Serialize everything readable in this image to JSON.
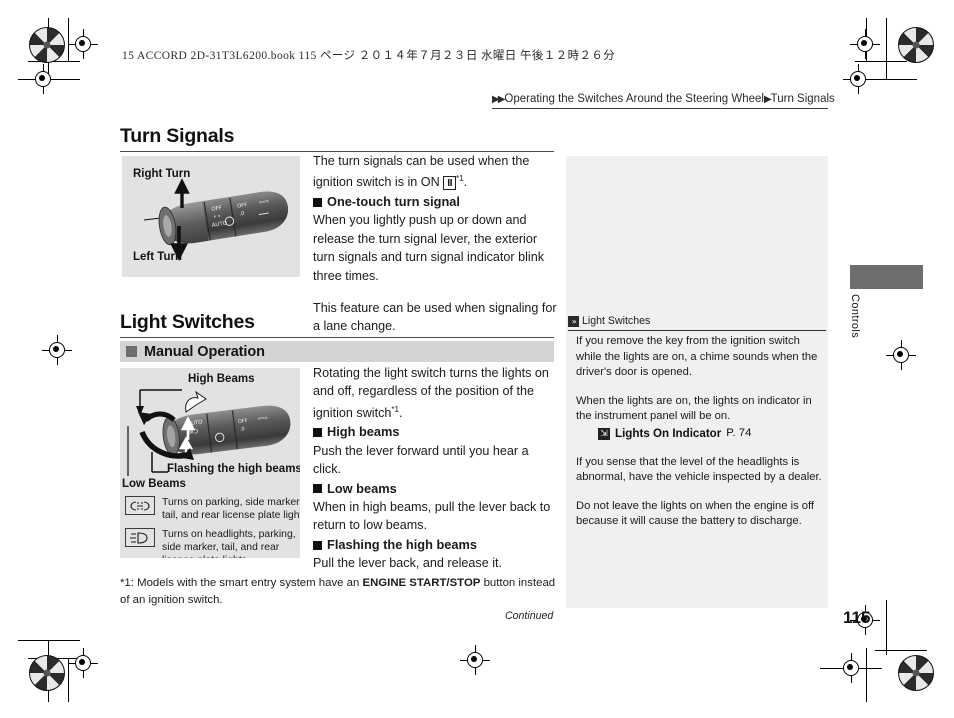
{
  "print_header": {
    "file_line": "15 ACCORD 2D-31T3L6200.book   115 ページ   ２０１４年７月２３日   水曜日   午後１２時２６分"
  },
  "breadcrumb": {
    "arrow": "▶▶",
    "path": "Operating the Switches Around the Steering Wheel",
    "sep": "▶",
    "current": "Turn Signals"
  },
  "turn_signals": {
    "heading": "Turn Signals",
    "figure": {
      "label_top": "Right Turn",
      "label_bottom": "Left Turn"
    },
    "intro_a": "The turn signals can be used when the ignition",
    "intro_b": "switch is in ON",
    "key_label": "II",
    "footmark": "*1",
    "intro_end": ".",
    "sub1_title": "One-touch turn signal",
    "sub1_body": "When you lightly push up or down and release the turn signal lever, the exterior turn signals and turn signal indicator blink three times.",
    "para2": "This feature can be used when signaling for a lane change."
  },
  "light_switches": {
    "heading": "Light Switches",
    "subsection": "Manual Operation",
    "figure": {
      "label_top": "High Beams",
      "label_bottom": "Flashing the high beams",
      "label_left": "Low Beams"
    },
    "legend": [
      {
        "icon": "parking-lights-icon",
        "text": "Turns on parking, side marker, tail, and rear license plate lights"
      },
      {
        "icon": "headlights-icon",
        "text": "Turns on headlights, parking, side marker, tail, and rear license plate lights"
      }
    ],
    "intro_a": "Rotating the light switch turns the lights on and off, regardless of the position of the",
    "intro_b": "ignition switch",
    "footmark": "*1",
    "intro_end": ".",
    "sub_high_title": "High beams",
    "sub_high_body": "Push the lever forward until you hear a click.",
    "sub_low_title": "Low beams",
    "sub_low_body": "When in high beams, pull the lever back to return to low beams.",
    "sub_flash_title": "Flashing the high beams",
    "sub_flash_body": "Pull the lever back, and release it."
  },
  "side_panel": {
    "marker": "»",
    "title": "Light Switches",
    "para1": "If you remove the key from the ignition switch while the lights are on, a chime sounds when the driver's door is opened.",
    "para2": "When the lights are on, the lights on indicator in the instrument panel will be on.",
    "xref_marker": "⇲",
    "xref_name": "Lights On Indicator",
    "xref_page": "P. 74",
    "para3": "If you sense that the level of the headlights is abnormal, have the vehicle inspected by a dealer.",
    "para4": "Do not leave the lights on when the engine is off because it will cause the battery to discharge."
  },
  "footer": {
    "footnote_pre": "*1: Models with the smart entry system have an ",
    "footnote_bold": "ENGINE START/STOP",
    "footnote_post": " button instead of an ignition switch.",
    "continued": "Continued",
    "page_number": "115"
  },
  "side_tab": {
    "label": "Controls"
  },
  "colors": {
    "figure_bg": "#e2e2e2",
    "subbar_bg": "#d4d4d4",
    "sidepanel_bg": "#f0f0f0",
    "tab_block": "#6e6e6e",
    "text": "#1b1b1b"
  }
}
